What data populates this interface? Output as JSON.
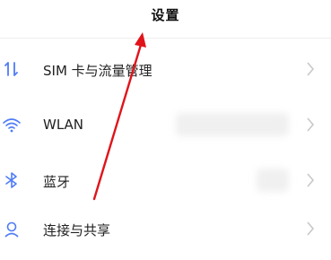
{
  "header": {
    "title": "设置"
  },
  "settings": {
    "items": [
      {
        "label": "SIM 卡与流量管理",
        "icon": "sim-transfer-icon"
      },
      {
        "label": "WLAN",
        "icon": "wifi-icon"
      },
      {
        "label": "蓝牙",
        "icon": "bluetooth-icon"
      },
      {
        "label": "连接与共享",
        "icon": "share-icon"
      }
    ]
  },
  "colors": {
    "accent": "#4f7cf6",
    "annotation_arrow": "#e0141a",
    "chevron": "#c8c8c8"
  }
}
